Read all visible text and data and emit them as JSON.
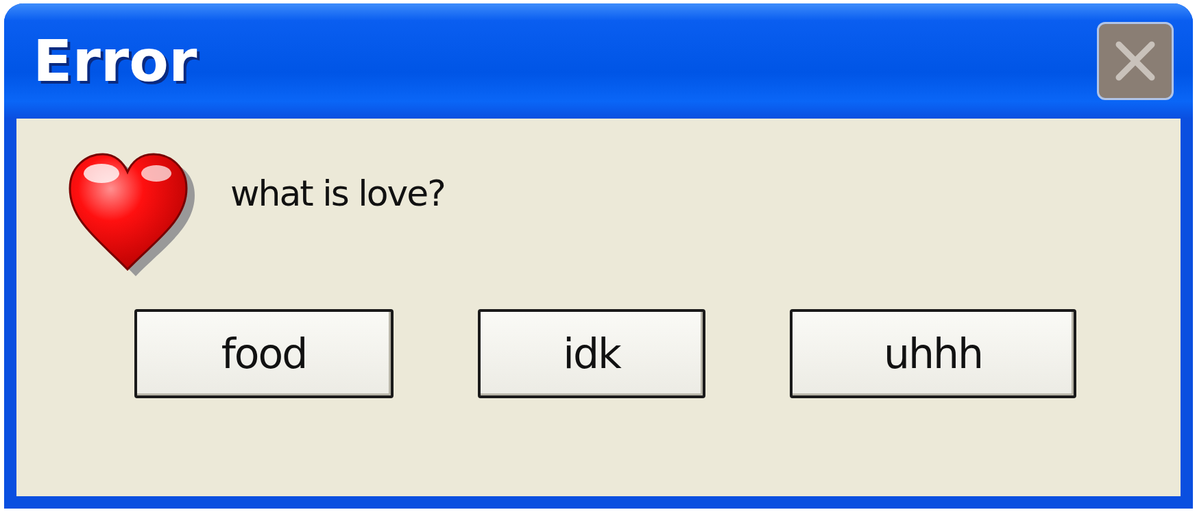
{
  "window": {
    "title": "Error"
  },
  "message": "what is love?",
  "buttons": [
    {
      "label": "food"
    },
    {
      "label": "idk"
    },
    {
      "label": "uhhh"
    }
  ]
}
